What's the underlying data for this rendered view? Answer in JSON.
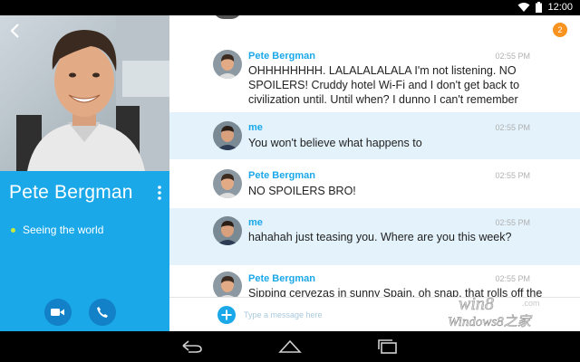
{
  "status_bar": {
    "time": "12:00"
  },
  "profile": {
    "name": "Pete Bergman",
    "mood": "Seeing the world"
  },
  "chat": {
    "unread_badge": "2",
    "messages": [
      {
        "sender": "Pete Bergman",
        "time": "02:55 PM",
        "text": "OHHHHHHHH. LALALALALALA I'm not listening. NO SPOILERS! Cruddy hotel Wi-Fi and I don't get back to civilization until. Until when? I dunno I can't remember"
      },
      {
        "sender": "me",
        "time": "02:55 PM",
        "text": "You won't believe what happens to"
      },
      {
        "sender": "Pete Bergman",
        "time": "02:55 PM",
        "text": "NO SPOILERS BRO!"
      },
      {
        "sender": "me",
        "time": "02:55 PM",
        "text": "hahahah just teasing you. Where are you this week?"
      },
      {
        "sender": "Pete Bergman",
        "time": "02:55 PM",
        "text": "Sipping cervezas in sunny Spain. oh snap, that rolls off the"
      }
    ],
    "compose_placeholder": "Type a message here"
  },
  "watermark": {
    "line1": "win8",
    "line2": ".com",
    "line3": "Windows8之家"
  },
  "icons": {
    "back": "chevron-left-icon",
    "menu": "more-vertical-icon",
    "video": "video-camera-icon",
    "call": "phone-icon",
    "add": "plus-icon",
    "nav_back": "back-arrow-icon",
    "nav_home": "home-icon",
    "nav_recent": "recent-apps-icon"
  },
  "colors": {
    "accent": "#1aa8e9",
    "badge": "#f7931e",
    "mood_dot": "#c8e83a"
  }
}
